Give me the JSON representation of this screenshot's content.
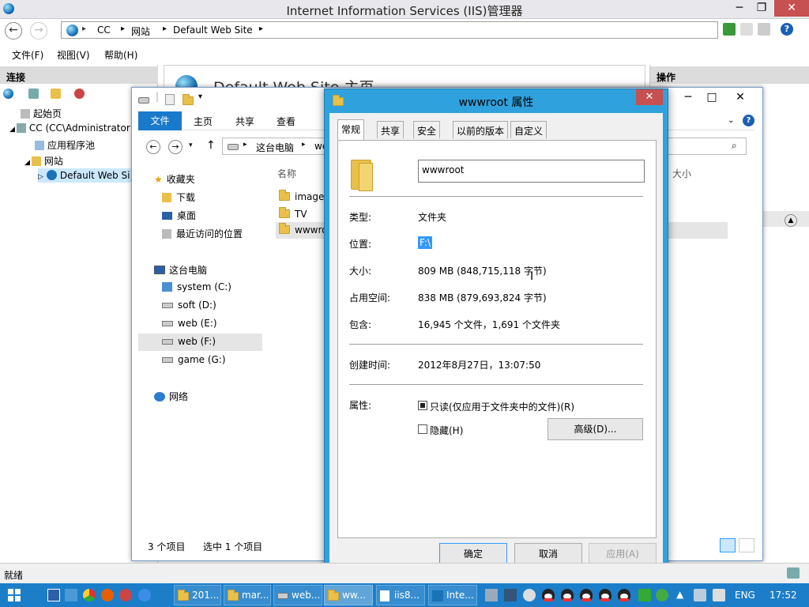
{
  "window": {
    "title": "Internet Information Services (IIS)管理器"
  },
  "address": {
    "crumbs": [
      "CC",
      "网站",
      "Default Web Site"
    ]
  },
  "menu": {
    "file": "文件(F)",
    "view": "视图(V)",
    "help": "帮助(H)"
  },
  "left_pane": {
    "header": "连接",
    "tree": [
      "起始页",
      "CC (CC\\Administrator",
      "应用程序池",
      "网站",
      "Default Web Si"
    ]
  },
  "center": {
    "title": "Default Web Site 主页"
  },
  "right_pane": {
    "header": "操作"
  },
  "status": {
    "text": "就绪"
  },
  "explorer": {
    "ribbon_tabs": [
      "文件",
      "主页",
      "共享",
      "查看"
    ],
    "path": [
      "这台电脑",
      "we"
    ],
    "nav": {
      "favorites": "收藏夹",
      "fav_items": [
        "下载",
        "桌面",
        "最近访问的位置"
      ],
      "this_pc": "这台电脑",
      "drives": [
        "system (C:)",
        "soft (D:)",
        "web (E:)",
        "web (F:)",
        "game (G:)"
      ],
      "network": "网络"
    },
    "col_name": "名称",
    "col_size": "大小",
    "files": [
      "images",
      "TV",
      "wwwro"
    ],
    "status_items": "3 个项目",
    "status_selected": "选中 1 个项目"
  },
  "dialog": {
    "title": "wwwroot 属性",
    "tabs": [
      "常规",
      "共享",
      "安全",
      "以前的版本",
      "自定义"
    ],
    "name_value": "wwwroot",
    "type_label": "类型:",
    "type_value": "文件夹",
    "location_label": "位置:",
    "location_value": "F:\\",
    "size_label": "大小:",
    "size_value": "809 MB (848,715,118 字节)",
    "disk_label": "占用空间:",
    "disk_value": "838 MB (879,693,824 字节)",
    "contains_label": "包含:",
    "contains_value": "16,945 个文件，1,691 个文件夹",
    "created_label": "创建时间:",
    "created_value": "2012年8月27日，13:07:50",
    "attr_label": "属性:",
    "readonly_label": "只读(仅应用于文件夹中的文件)(R)",
    "hidden_label": "隐藏(H)",
    "advanced_button": "高级(D)...",
    "ok_button": "确定",
    "cancel_button": "取消",
    "apply_button": "应用(A)"
  },
  "taskbar": {
    "items": [
      "201...",
      "mar...",
      "web...",
      "ww...",
      "iis8...",
      "Inte..."
    ],
    "lang": "ENG",
    "time": "17:52"
  }
}
